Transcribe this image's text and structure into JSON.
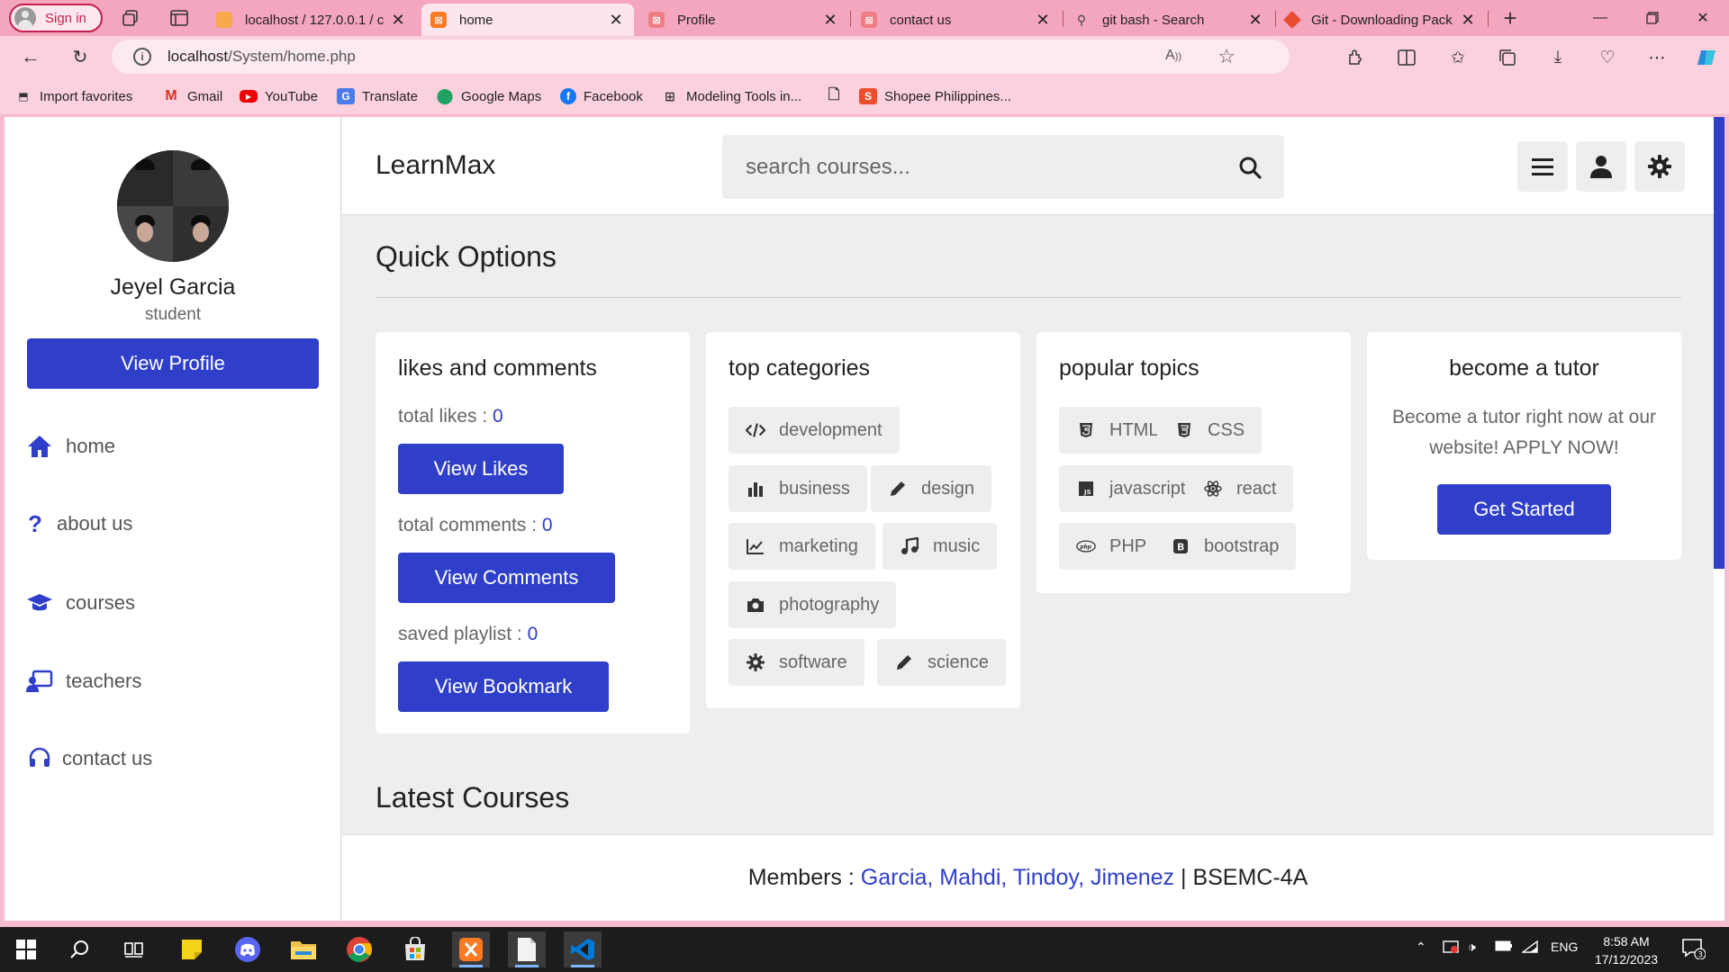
{
  "browser": {
    "profile_label": "Sign in",
    "tabs": [
      {
        "title": "localhost / 127.0.0.1 / c",
        "active": false
      },
      {
        "title": "home",
        "active": true
      },
      {
        "title": "Profile",
        "active": false
      },
      {
        "title": "contact us",
        "active": false
      },
      {
        "title": "git bash - Search",
        "active": false
      },
      {
        "title": "Git - Downloading Pack",
        "active": false
      }
    ],
    "url_host": "localhost",
    "url_path": "/System/home.php",
    "favorites": [
      {
        "label": "Import favorites"
      },
      {
        "label": "Gmail"
      },
      {
        "label": "YouTube"
      },
      {
        "label": "Translate"
      },
      {
        "label": "Google Maps"
      },
      {
        "label": "Facebook"
      },
      {
        "label": "Modeling Tools in..."
      },
      {
        "label": ""
      },
      {
        "label": "Shopee Philippines..."
      }
    ]
  },
  "sidebar": {
    "name": "Jeyel Garcia",
    "role": "student",
    "profile_button": "View Profile",
    "nav": [
      {
        "label": "home",
        "icon": "home-icon"
      },
      {
        "label": "about us",
        "icon": "question-icon"
      },
      {
        "label": "courses",
        "icon": "graduation-cap-icon"
      },
      {
        "label": "teachers",
        "icon": "teacher-icon"
      },
      {
        "label": "contact us",
        "icon": "headset-icon"
      }
    ]
  },
  "header": {
    "logo": "LearnMax",
    "search_placeholder": "search courses..."
  },
  "main": {
    "quick_options_title": "Quick Options",
    "latest_courses_title": "Latest Courses",
    "likes_card": {
      "title": "likes and comments",
      "likes_label": "total likes : ",
      "likes_value": "0",
      "likes_button": "View Likes",
      "comments_label": "total comments : ",
      "comments_value": "0",
      "comments_button": "View Comments",
      "playlist_label": "saved playlist : ",
      "playlist_value": "0",
      "playlist_button": "View Bookmark"
    },
    "categories_card": {
      "title": "top categories",
      "items": [
        {
          "label": "development",
          "icon": "code-icon"
        },
        {
          "label": "business",
          "icon": "bar-chart-icon"
        },
        {
          "label": "design",
          "icon": "pen-icon"
        },
        {
          "label": "marketing",
          "icon": "line-chart-icon"
        },
        {
          "label": "music",
          "icon": "music-icon"
        },
        {
          "label": "photography",
          "icon": "camera-icon"
        },
        {
          "label": "software",
          "icon": "gear-icon"
        },
        {
          "label": "science",
          "icon": "pen-icon"
        }
      ]
    },
    "topics_card": {
      "title": "popular topics",
      "items": [
        {
          "label": "HTML",
          "icon": "html5-icon"
        },
        {
          "label": "CSS",
          "icon": "css3-icon"
        },
        {
          "label": "javascript",
          "icon": "js-icon"
        },
        {
          "label": "react",
          "icon": "react-icon"
        },
        {
          "label": "PHP",
          "icon": "php-icon"
        },
        {
          "label": "bootstrap",
          "icon": "bootstrap-icon"
        }
      ]
    },
    "tutor_card": {
      "title": "become a tutor",
      "text": "Become a tutor right now at our website! APPLY NOW!",
      "button": "Get Started"
    }
  },
  "footer": {
    "prefix": "Members : ",
    "members": "Garcia, Mahdi, Tindoy, Jimenez",
    "suffix": " | BSEMC-4A"
  },
  "taskbar": {
    "language": "ENG",
    "time": "8:58 AM",
    "date": "17/12/2023",
    "notification_count": "3"
  },
  "colors": {
    "accent": "#2f3fc9",
    "chrome_tab_bar": "#f4a6bf",
    "chrome_toolbar": "#fbd1de",
    "page_background": "#eeeeee"
  }
}
